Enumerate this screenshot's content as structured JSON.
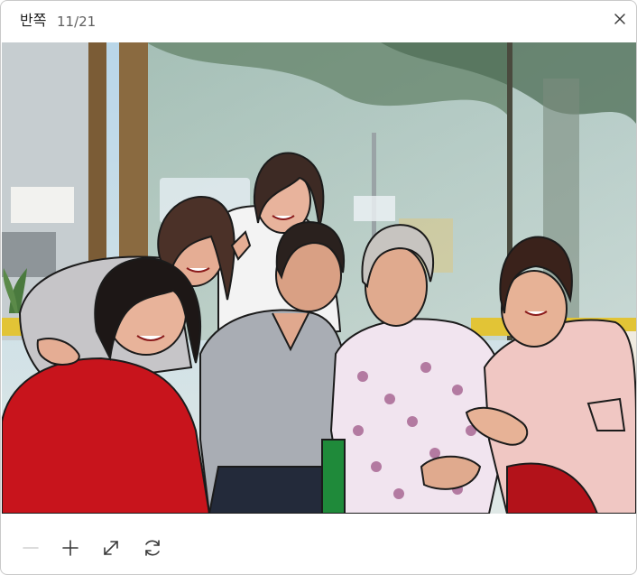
{
  "window": {
    "title": "반쪽",
    "counter": "11/21"
  },
  "icons": {
    "close": "close-icon",
    "zoom_out": "minus-icon",
    "zoom_in": "plus-icon",
    "fit": "expand-arrows-icon",
    "rotate": "rotate-icon"
  },
  "toolbar": {
    "zoom_out_enabled": false
  },
  "colors": {
    "accent": "#1f1f1f",
    "icon": "#3a3a3a",
    "icon_disabled": "#9a9a9a"
  }
}
